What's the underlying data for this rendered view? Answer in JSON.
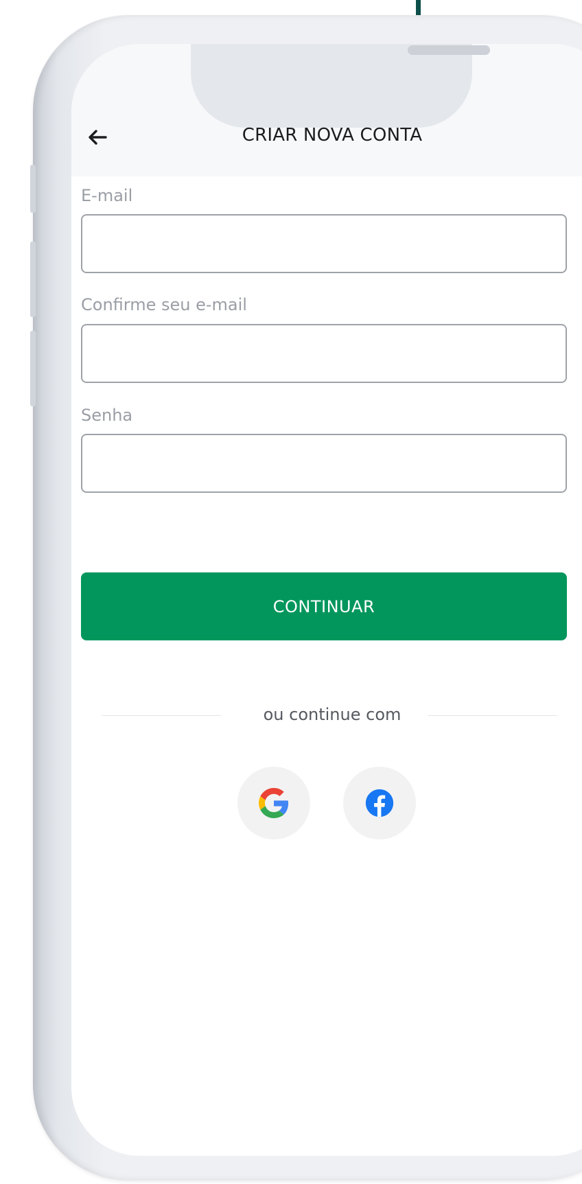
{
  "header": {
    "title": "CRIAR NOVA CONTA",
    "back_icon": "arrow-left-icon"
  },
  "form": {
    "email_label": "E-mail",
    "email_value": "",
    "confirm_email_label": "Confirme seu e-mail",
    "confirm_email_value": "",
    "password_label": "Senha",
    "password_value": ""
  },
  "actions": {
    "continue_label": "CONTINUAR"
  },
  "social": {
    "divider_text": "ou continue com",
    "providers": [
      {
        "name": "Google",
        "icon": "google-icon"
      },
      {
        "name": "Facebook",
        "icon": "facebook-icon"
      }
    ]
  },
  "colors": {
    "primary": "#03965c",
    "connector": "#0d4f4a",
    "facebook": "#1877f2"
  }
}
